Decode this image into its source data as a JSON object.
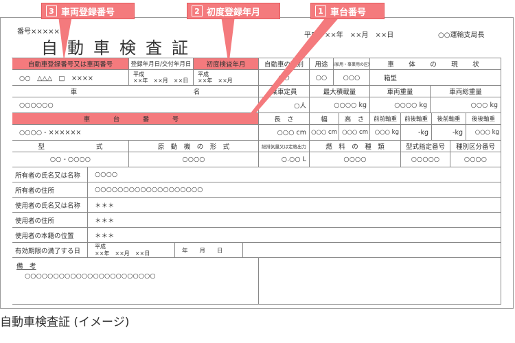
{
  "header": {
    "number_label": "番号××××××",
    "title": "自動車検査証",
    "date_text": "平成　××年　××月　××日",
    "bureau": "○○運輸支局長"
  },
  "callouts": [
    {
      "num": "3",
      "label": "車両登録番号"
    },
    {
      "num": "2",
      "label": "初度登録年月"
    },
    {
      "num": "1",
      "label": "車台番号"
    }
  ],
  "row1": {
    "reg_no_header": "自動車登録番号又は車両番号",
    "reg_date_header": "登録年月日/交付年月日",
    "first_reg_header": "初度検査年月",
    "vehicle_kind_header": "自動車の種別",
    "use_header": "用途",
    "business_header": "自家用・事業用の区別",
    "body_state_header": "車　体　の　現　状",
    "reg_no_value": "○○　△△△　□　××××",
    "reg_date_era": "平成",
    "reg_date_value": "××年　××月　××日",
    "first_reg_era": "平成",
    "first_reg_value": "××年　××月",
    "vehicle_kind_value": "○○",
    "use_value": "○○",
    "business_value": "○○○",
    "body_state_value": "箱型"
  },
  "row2": {
    "car_name_header_1": "車",
    "car_name_header_2": "名",
    "capacity_header": "乗車定員",
    "max_load_header": "最大積載量",
    "weight_header": "車両重量",
    "gross_weight_header": "車両総重量",
    "car_name_value": "○○○○○○",
    "capacity_value": "○人",
    "max_load_value": "○○○○ kg",
    "weight_value": "○○○○ kg",
    "gross_weight_value": "○○○ kg"
  },
  "row3": {
    "chassis_header": "車　台　番　号",
    "length_header": "長　さ",
    "width_header": "幅",
    "height_header": "高　さ",
    "ff_axle_header": "前前軸重",
    "fr_axle_header": "前後軸重",
    "rf_axle_header": "後前軸重",
    "rr_axle_header": "後後軸重",
    "chassis_value": "○○○○ - ××××××",
    "length_value": "○○○ cm",
    "width_value": "○○○ cm",
    "height_value": "○○○ cm",
    "ff_axle_value": "○○○ kg",
    "fr_axle_value": "-kg",
    "rf_axle_value": "-kg",
    "rr_axle_value": "○○○ kg"
  },
  "row4": {
    "model_header_1": "型",
    "model_header_2": "式",
    "engine_header": "原　動　機　の　形　式",
    "displacement_header": "総排気量又は定格出力",
    "fuel_header": "燃　料　の　種　類",
    "type_designation_header": "型式指定番号",
    "category_header": "種別区分番号",
    "model_value": "○○ - ○○○○",
    "engine_value": "○○○○",
    "displacement_value": "○.○○ L",
    "fuel_value": "○○○○",
    "type_designation_value": "○○○○○",
    "category_value": "○○○○"
  },
  "owner": {
    "owner_name_label": "所有者の氏名又は名称",
    "owner_name_value": "○○○○",
    "owner_address_label": "所有者の住所",
    "owner_address_value": "○○○○○○○○○○○○○○○○○○○",
    "user_name_label": "使用者の氏名又は名称",
    "user_name_value": "＊＊＊",
    "user_address_label": "使用者の住所",
    "user_address_value": "＊＊＊",
    "user_domicile_label": "使用者の本籍の位置",
    "user_domicile_value": "＊＊＊",
    "expiry_label": "有効期限の満了する日",
    "expiry_era": "平成",
    "expiry_value": "××年　××月　××日",
    "expiry_blank": "年　　月　　日"
  },
  "remarks": {
    "label": "備　考",
    "value": "○○○○○○○○○○○○○○○○○○○○○○○"
  },
  "caption": "自動車検査証 (イメージ)"
}
